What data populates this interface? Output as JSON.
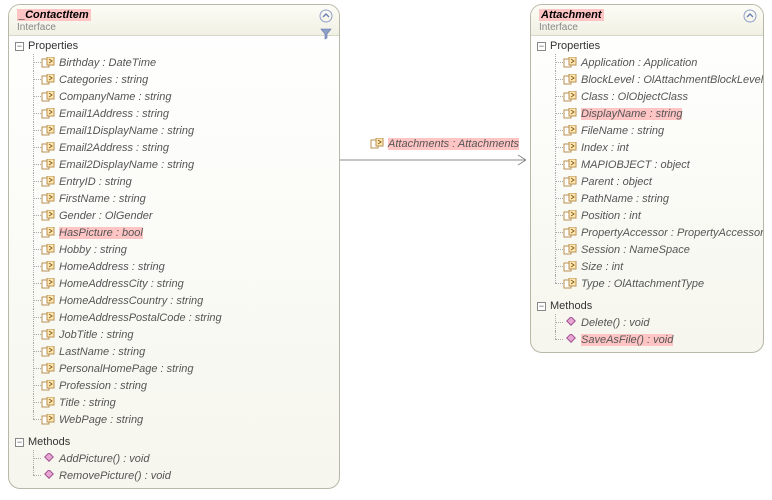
{
  "left_class": {
    "name": "_ContactItem",
    "stereotype": "Interface",
    "sections": {
      "properties": {
        "title": "Properties",
        "items": [
          {
            "label": "Birthday : DateTime"
          },
          {
            "label": "Categories : string"
          },
          {
            "label": "CompanyName : string"
          },
          {
            "label": "Email1Address : string"
          },
          {
            "label": "Email1DisplayName : string"
          },
          {
            "label": "Email2Address : string"
          },
          {
            "label": "Email2DisplayName : string"
          },
          {
            "label": "EntryID : string"
          },
          {
            "label": "FirstName : string"
          },
          {
            "label": "Gender : OlGender"
          },
          {
            "label": "HasPicture : bool",
            "highlight": true
          },
          {
            "label": "Hobby : string"
          },
          {
            "label": "HomeAddress : string"
          },
          {
            "label": "HomeAddressCity : string"
          },
          {
            "label": "HomeAddressCountry : string"
          },
          {
            "label": "HomeAddressPostalCode : string"
          },
          {
            "label": "JobTitle : string"
          },
          {
            "label": "LastName : string"
          },
          {
            "label": "PersonalHomePage : string"
          },
          {
            "label": "Profession : string"
          },
          {
            "label": "Title : string"
          },
          {
            "label": "WebPage : string"
          }
        ]
      },
      "methods": {
        "title": "Methods",
        "items": [
          {
            "label": "AddPicture() : void"
          },
          {
            "label": "RemovePicture() : void"
          }
        ]
      }
    }
  },
  "right_class": {
    "name": "Attachment",
    "stereotype": "Interface",
    "sections": {
      "properties": {
        "title": "Properties",
        "items": [
          {
            "label": "Application : Application"
          },
          {
            "label": "BlockLevel : OlAttachmentBlockLevel"
          },
          {
            "label": "Class : OlObjectClass"
          },
          {
            "label": "DisplayName : string",
            "highlight": true
          },
          {
            "label": "FileName : string"
          },
          {
            "label": "Index : int"
          },
          {
            "label": "MAPIOBJECT : object"
          },
          {
            "label": "Parent : object"
          },
          {
            "label": "PathName : string"
          },
          {
            "label": "Position : int"
          },
          {
            "label": "PropertyAccessor : PropertyAccessor"
          },
          {
            "label": "Session : NameSpace"
          },
          {
            "label": "Size : int"
          },
          {
            "label": "Type : OlAttachmentType"
          }
        ]
      },
      "methods": {
        "title": "Methods",
        "items": [
          {
            "label": "Delete() : void"
          },
          {
            "label": "SaveAsFile() : void",
            "highlight": true
          }
        ]
      }
    }
  },
  "association": {
    "label": "Attachments : Attachments",
    "highlight": true
  }
}
